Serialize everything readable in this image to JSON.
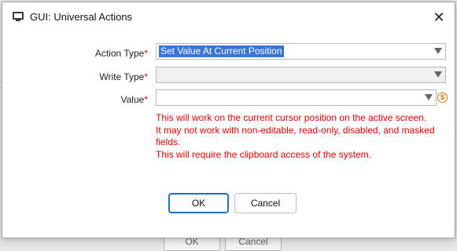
{
  "dialog": {
    "title": "GUI: Universal Actions",
    "close_glyph": "✕"
  },
  "form": {
    "action_type": {
      "label": "Action Type",
      "required_mark": "*",
      "value": "Set Value At Current Position"
    },
    "write_type": {
      "label": "Write Type",
      "required_mark": "*",
      "value": ""
    },
    "value": {
      "label": "Value",
      "required_mark": "*",
      "value": ""
    }
  },
  "warning": {
    "lines": [
      "This will work on the current cursor position on the active screen.",
      "It may not work with non-editable, read-only, disabled, and masked fields.",
      "This will require the clipboard access of the system."
    ]
  },
  "buttons": {
    "ok": "OK",
    "cancel": "Cancel"
  },
  "background": {
    "ok": "OK",
    "cancel": "Cancel"
  },
  "icons": {
    "title": "app-window-icon",
    "value_variable": "dollar-variable-icon"
  },
  "colors": {
    "accent": "#1a73c9",
    "selection": "#3a74d8",
    "warning": "#e00000",
    "required": "#d60000",
    "variable_icon": "#e07000"
  }
}
